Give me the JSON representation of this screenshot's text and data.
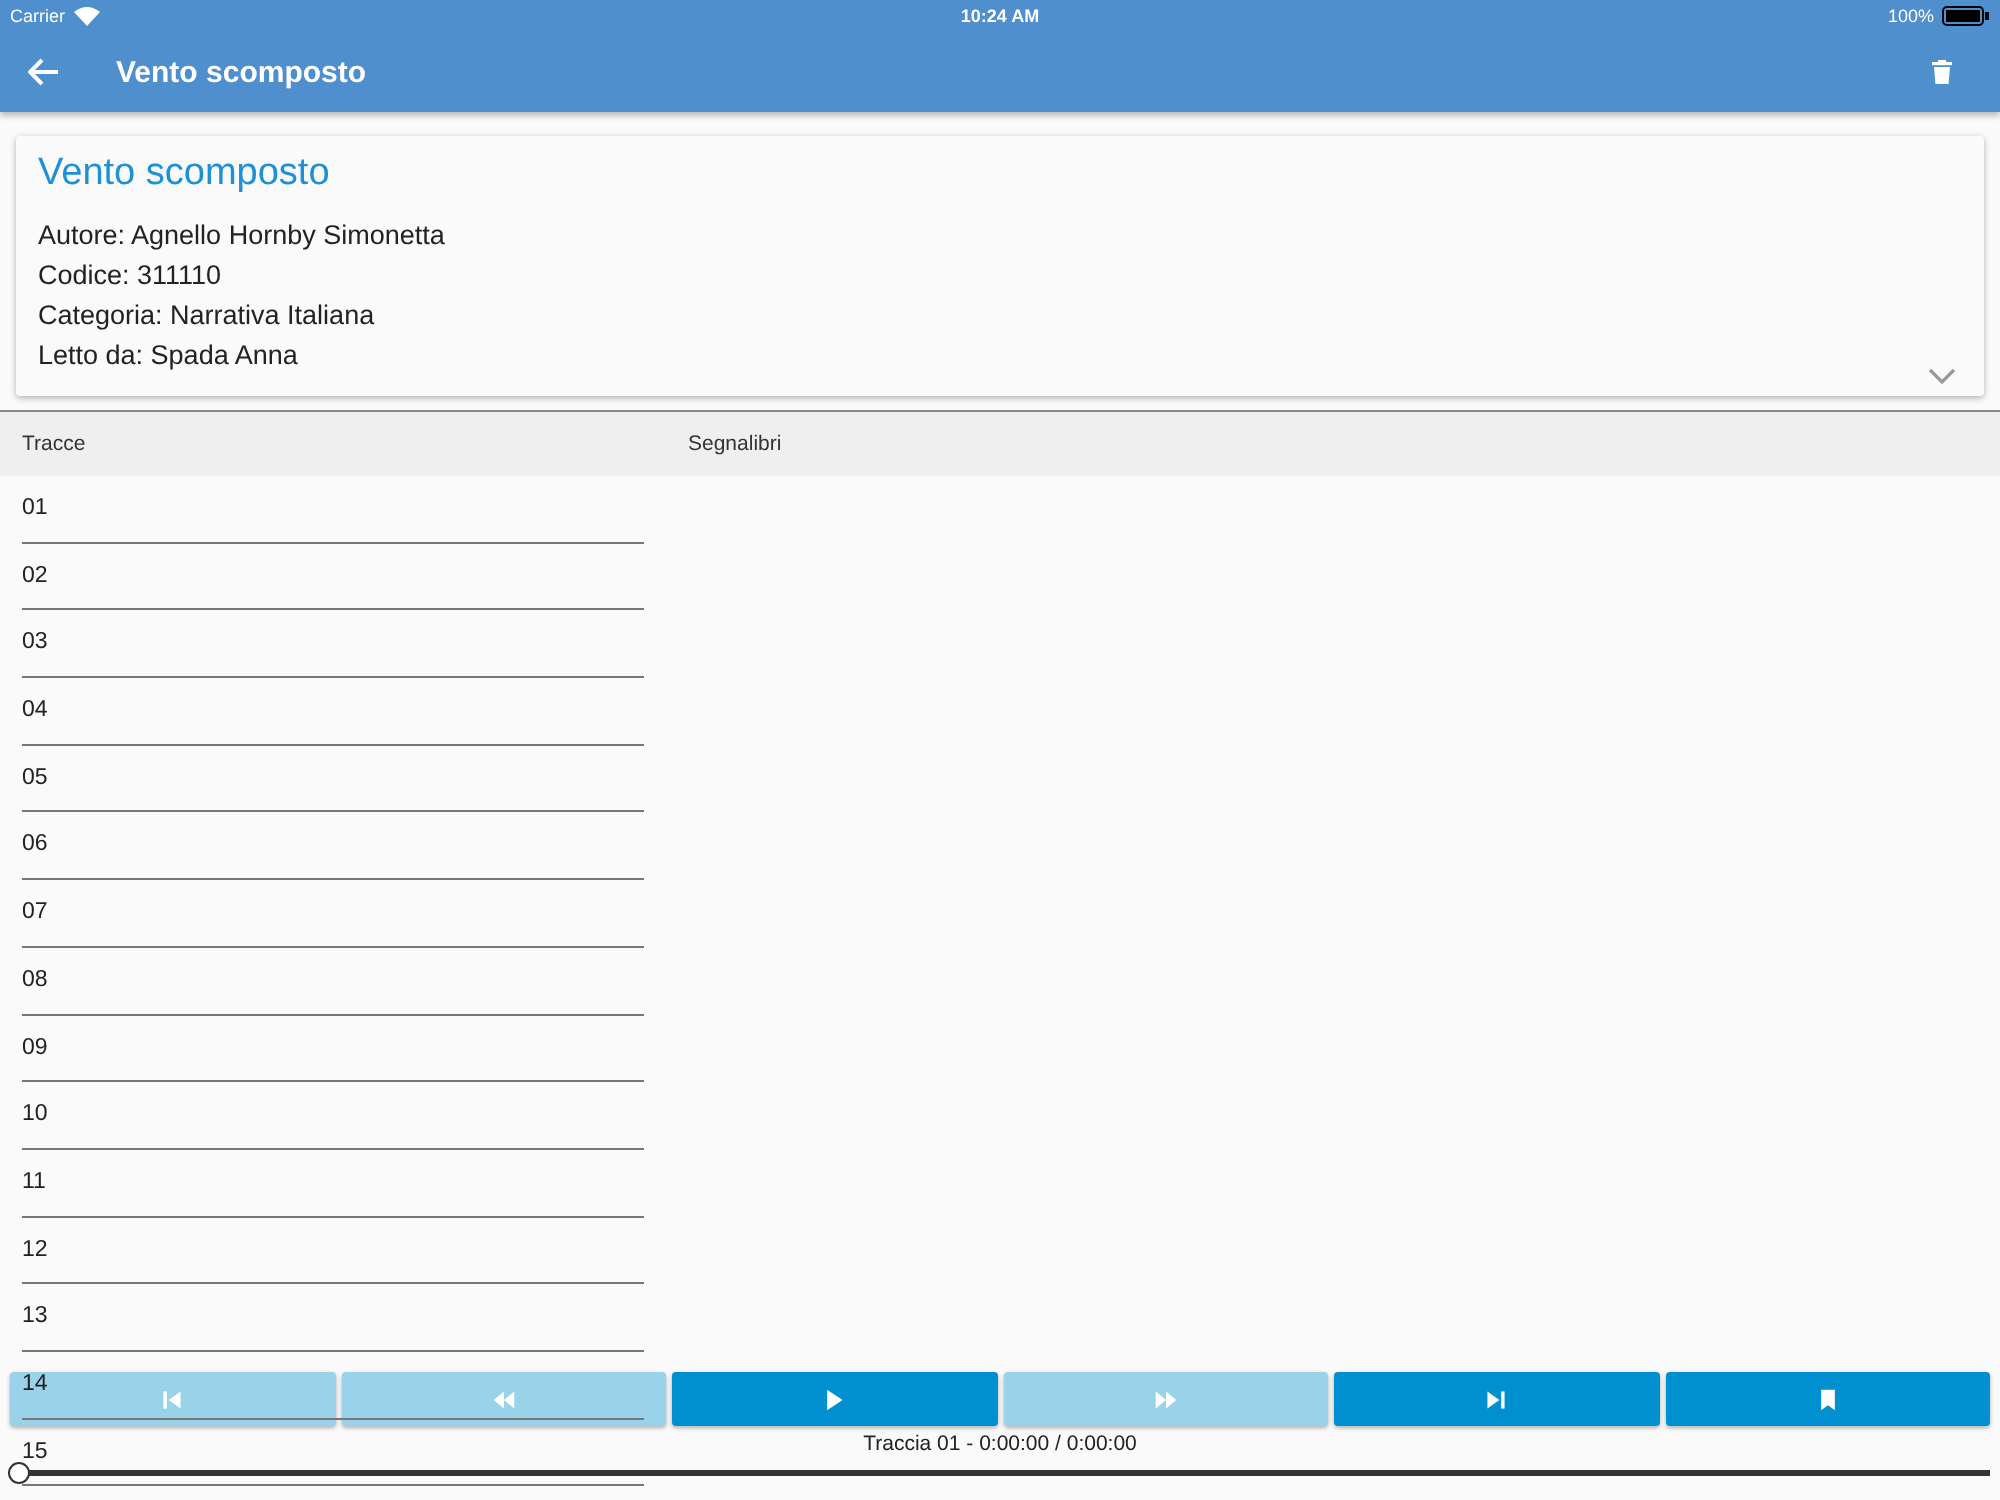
{
  "status_bar": {
    "carrier": "Carrier",
    "time": "10:24 AM",
    "battery": "100%"
  },
  "app_bar": {
    "title": "Vento scomposto"
  },
  "book": {
    "title": "Vento scomposto",
    "expanded": false,
    "details": [
      "Autore: Agnello Hornby Simonetta",
      "Codice: 311110",
      "Categoria: Narrativa Italiana",
      "Letto da: Spada Anna"
    ]
  },
  "columns": [
    "Tracce",
    "Segnalibri"
  ],
  "tracks": [
    "01",
    "02",
    "03",
    "04",
    "05",
    "06",
    "07",
    "08",
    "09",
    "10",
    "11",
    "12",
    "13",
    "14",
    "15"
  ],
  "player": {
    "buttons": [
      {
        "kind": "first",
        "disabled": true
      },
      {
        "kind": "rewind",
        "disabled": true
      },
      {
        "kind": "play",
        "disabled": false
      },
      {
        "kind": "forward",
        "disabled": true
      },
      {
        "kind": "last",
        "disabled": false
      },
      {
        "kind": "bookmark",
        "disabled": false
      }
    ],
    "status": "Traccia 01 - 0:00:00 / 0:00:00",
    "level": 0
  }
}
